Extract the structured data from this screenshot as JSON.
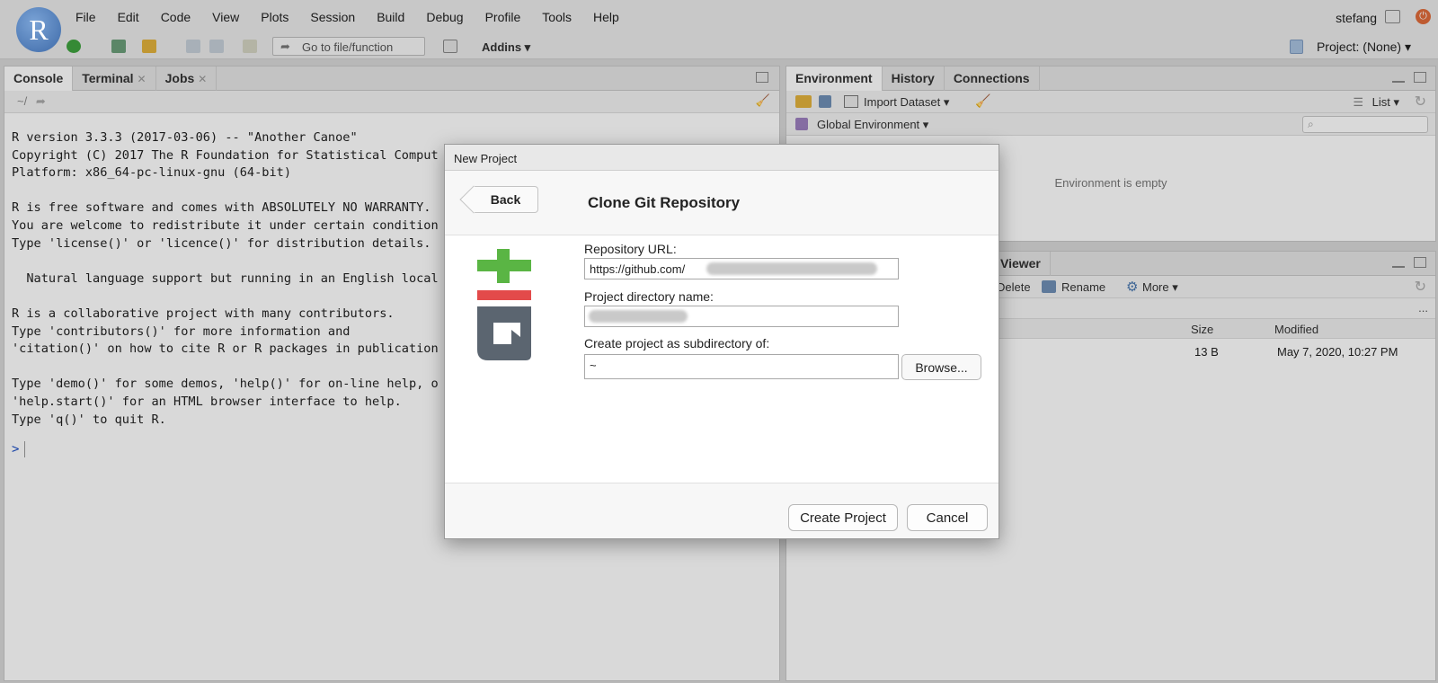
{
  "app": {
    "logo_letter": "R",
    "menus": [
      "File",
      "Edit",
      "Code",
      "View",
      "Plots",
      "Session",
      "Build",
      "Debug",
      "Profile",
      "Tools",
      "Help"
    ],
    "user": "stefang"
  },
  "toolbar": {
    "goto_placeholder": "Go to file/function",
    "addins_label": "Addins ▾",
    "project_label": "Project: (None) ▾"
  },
  "console": {
    "tabs": [
      {
        "label": "Console",
        "closable": false
      },
      {
        "label": "Terminal",
        "closable": true
      },
      {
        "label": "Jobs",
        "closable": true
      }
    ],
    "path": "~/",
    "output": "R version 3.3.3 (2017-03-06) -- \"Another Canoe\"\nCopyright (C) 2017 The R Foundation for Statistical Comput\nPlatform: x86_64-pc-linux-gnu (64-bit)\n\nR is free software and comes with ABSOLUTELY NO WARRANTY.\nYou are welcome to redistribute it under certain condition\nType 'license()' or 'licence()' for distribution details.\n\n  Natural language support but running in an English local\n\nR is a collaborative project with many contributors.\nType 'contributors()' for more information and\n'citation()' on how to cite R or R packages in publication\n\nType 'demo()' for some demos, 'help()' for on-line help, o\n'help.start()' for an HTML browser interface to help.\nType 'q()' to quit R.",
    "prompt": ">"
  },
  "environment": {
    "tabs": [
      "Environment",
      "History",
      "Connections"
    ],
    "import_label": "Import Dataset ▾",
    "list_label": "List ▾",
    "scope_label": "Global Environment ▾",
    "empty_text": "Environment is empty"
  },
  "files": {
    "visible_tab": "Viewer",
    "delete_label": "Delete",
    "rename_label": "Rename",
    "more_label": "More ▾",
    "col_size": "Size",
    "col_modified": "Modified",
    "row_size": "13 B",
    "row_modified": "May 7, 2020, 10:27 PM",
    "ellipsis": "..."
  },
  "dialog": {
    "window_title": "New Project",
    "back_label": "Back",
    "title": "Clone Git Repository",
    "repo_url_label": "Repository URL:",
    "repo_url_value": "https://github.com/",
    "dir_name_label": "Project directory name:",
    "dir_name_value": "",
    "subdir_label": "Create project as subdirectory of:",
    "subdir_value": "~",
    "browse_label": "Browse...",
    "create_label": "Create Project",
    "cancel_label": "Cancel"
  },
  "colors": {
    "git_green": "#5ab544",
    "git_red": "#e34a4a",
    "git_gray": "#5b6570",
    "prompt_blue": "#1a4dc4"
  }
}
